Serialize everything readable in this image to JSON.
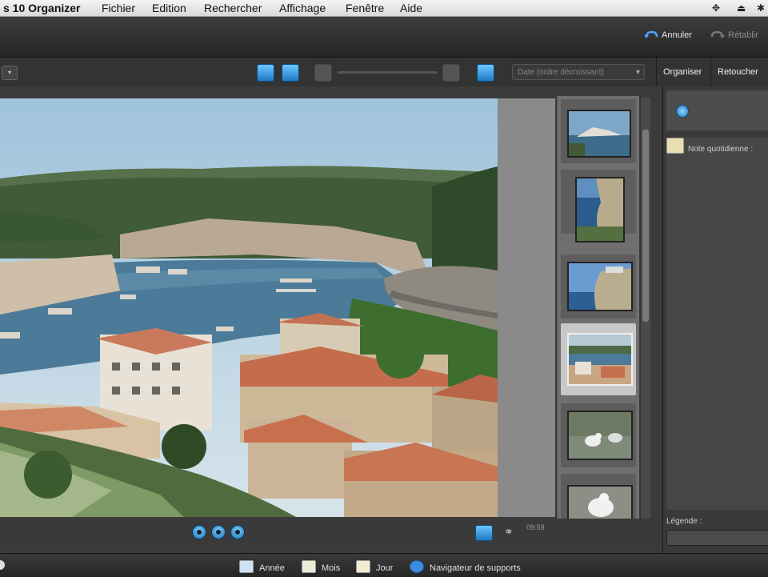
{
  "menubar": {
    "app_name": "s 10 Organizer",
    "items": [
      "Fichier",
      "Edition",
      "Rechercher",
      "Affichage",
      "Fenêtre",
      "Aide"
    ]
  },
  "actions": {
    "undo_label": "Annuler",
    "redo_label": "Rétablir"
  },
  "toolbar": {
    "sort_value": "Date (ordre décroissant)",
    "tabs": [
      "Organiser",
      "Retoucher"
    ]
  },
  "viewer": {
    "photo_description_icon": "harbor-photo",
    "thumbnails": [
      "harbor-town",
      "cliff-coast",
      "cliff-town",
      "harbor-aerial",
      "seagull",
      "seagull-close"
    ],
    "selected_index": 3,
    "time_label": "09:59"
  },
  "right_panel": {
    "note_label": "Note quotidienne :",
    "legend_label": "Légende :"
  },
  "statusbar": {
    "items": [
      "Année",
      "Mois",
      "Jour",
      "Navigateur de supports"
    ]
  }
}
